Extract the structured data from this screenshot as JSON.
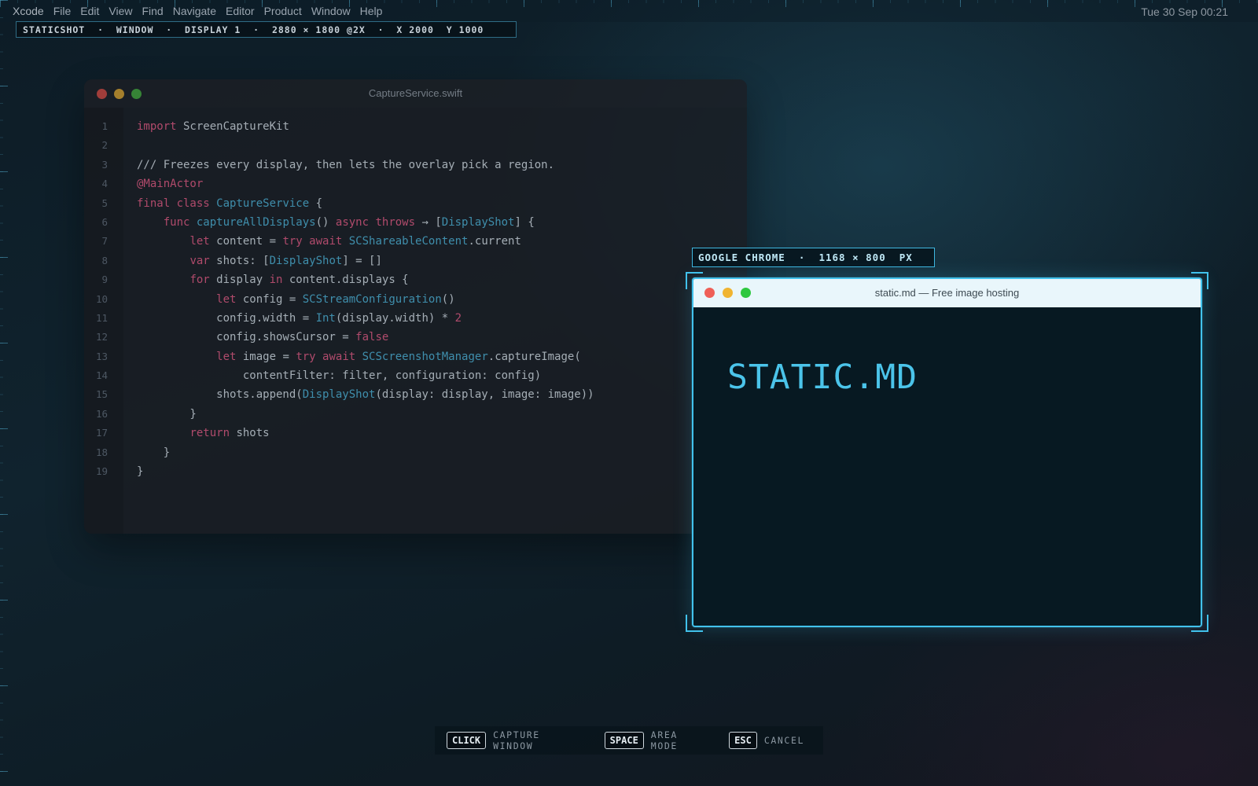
{
  "menubar": {
    "app": "Xcode",
    "items": [
      "File",
      "Edit",
      "View",
      "Find",
      "Navigate",
      "Editor",
      "Product",
      "Window",
      "Help"
    ],
    "clock": "Tue 30 Sep  00:21"
  },
  "status_chip": "STATICSHOT  ·  WINDOW  ·  DISPLAY 1  ·  2880 × 1800 @2X  ·  X 2000  Y 1000",
  "editor": {
    "title": "CaptureService.swift",
    "line_numbers": [
      "1",
      "2",
      "3",
      "4",
      "5",
      "6",
      "7",
      "8",
      "9",
      "10",
      "11",
      "12",
      "13",
      "14",
      "15",
      "16",
      "17",
      "18",
      "19"
    ]
  },
  "chrome": {
    "label": "GOOGLE CHROME  ·  1168 × 800  PX",
    "title": "static.md — Free image hosting",
    "site_title": "STATIC.MD"
  },
  "hints": [
    {
      "key": "CLICK",
      "label": "CAPTURE WINDOW"
    },
    {
      "key": "SPACE",
      "label": "AREA MODE"
    },
    {
      "key": "ESC",
      "label": "CANCEL"
    }
  ],
  "colors": {
    "accent": "#42c2ec",
    "keyword": "#d4547a",
    "type": "#4aa6c8"
  }
}
